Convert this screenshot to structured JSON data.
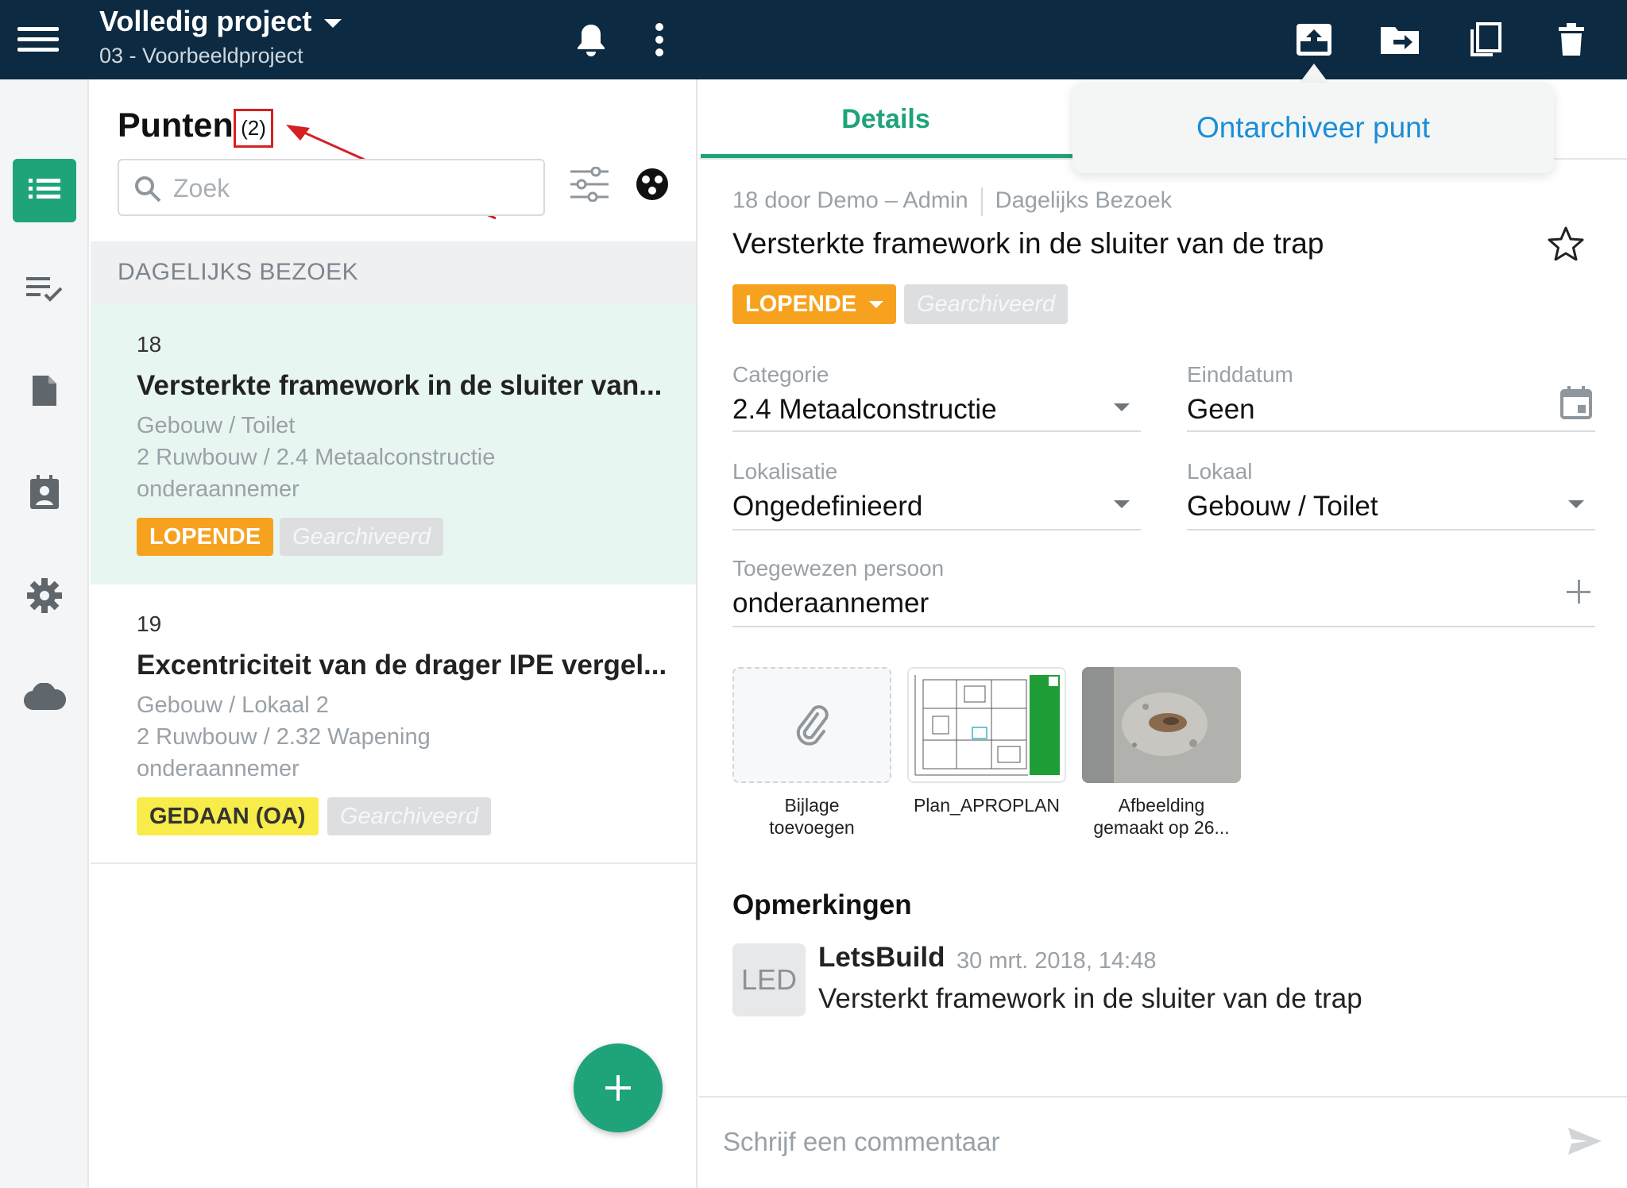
{
  "header": {
    "project_title": "Volledig project",
    "project_subtitle": "03 - Voorbeeldproject",
    "icons": [
      "menu-icon",
      "bell-icon",
      "more-vert-icon",
      "unarchive-icon",
      "move-icon",
      "copy-icon",
      "delete-icon"
    ],
    "background_color": "#0c2a41"
  },
  "rail": {
    "items": [
      "list-icon",
      "checklist-icon",
      "document-icon",
      "contact-icon",
      "settings-icon",
      "cloud-icon"
    ],
    "active_color": "#1fa37a"
  },
  "list": {
    "title": "Punten",
    "count": "(2)",
    "search_placeholder": "Zoek",
    "section": "DAGELIJKS BEZOEK",
    "items": [
      {
        "number": "18",
        "title": "Versterkte framework in de sluiter van...",
        "location": "Gebouw / Toilet",
        "category": "2 Ruwbouw / 2.4 Metaalconstructie",
        "assignee": "onderaannemer",
        "status": "LOPENDE",
        "archived": "Gearchiveerd"
      },
      {
        "number": "19",
        "title": "Excentriciteit van de drager IPE vergel...",
        "location": "Gebouw / Lokaal 2",
        "category": "2 Ruwbouw / 2.32 Wapening",
        "assignee": "onderaannemer",
        "status": "GEDAAN (OA)",
        "archived": "Gearchiveerd"
      }
    ],
    "fab_label": "+"
  },
  "detail": {
    "tab": "Details",
    "popover": "Ontarchiveer punt",
    "meta_author": "18 door Demo – Admin",
    "meta_visit": "Dagelijks Bezoek",
    "title": "Versterkte framework in de sluiter van de trap",
    "status": "LOPENDE",
    "archived": "Gearchiveerd",
    "fields": {
      "categorie": {
        "label": "Categorie",
        "value": "2.4 Metaalconstructie"
      },
      "einddatum": {
        "label": "Einddatum",
        "value": "Geen"
      },
      "lokalisatie": {
        "label": "Lokalisatie",
        "value": "Ongedefinieerd"
      },
      "lokaal": {
        "label": "Lokaal",
        "value": "Gebouw / Toilet"
      },
      "toegewezen": {
        "label": "Toegewezen persoon",
        "value": "onderaannemer"
      }
    },
    "attachments": [
      {
        "caption_1": "Bijlage",
        "caption_2": "toevoegen"
      },
      {
        "caption_1": "Plan_APROPLAN"
      },
      {
        "caption_1": "Afbeelding",
        "caption_2": "gemaakt op 26..."
      }
    ],
    "comments_heading": "Opmerkingen",
    "comment": {
      "avatar": "LED",
      "author": "LetsBuild",
      "date": "30 mrt. 2018, 14:48",
      "text": "Versterkt framework in de sluiter van de trap"
    },
    "composer_placeholder": "Schrijf een commentaar"
  },
  "colors": {
    "accent": "#1fa37a",
    "status_orange": "#f6a21e",
    "status_yellow": "#f7ec4a",
    "link_blue": "#1a8ed8",
    "annotation_red": "#d42020"
  }
}
